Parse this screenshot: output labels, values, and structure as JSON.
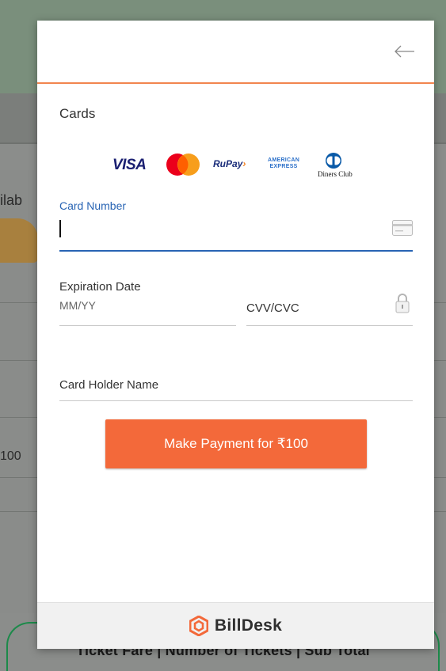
{
  "background": {
    "left_fragment_1": "ilab",
    "left_fragment_2": "100",
    "bottom_bar": "Ticket Fare  |  Number of Tickets  |  Sub Total"
  },
  "modal": {
    "back_icon": "arrow-left-icon",
    "section_title": "Cards",
    "card_brands": [
      "VISA",
      "Mastercard",
      "RuPay",
      "American Express",
      "Diners Club"
    ],
    "visa_text": "VISA",
    "rupay_text": "RuPay",
    "amex_line1": "AMERICAN",
    "amex_line2": "EXPRESS",
    "diners_text": "Diners Club",
    "card_number": {
      "label": "Card Number",
      "value": ""
    },
    "expiration": {
      "label": "Expiration Date",
      "placeholder": "MM/YY"
    },
    "cvv": {
      "placeholder": "CVV/CVC"
    },
    "holder_name": {
      "placeholder": "Card Holder Name"
    },
    "pay_button": "Make Payment for ₹100",
    "footer_brand": "BillDesk"
  },
  "colors": {
    "accent": "#f3693a",
    "focus_blue": "#2864b4",
    "header_rule": "#f2854e"
  }
}
